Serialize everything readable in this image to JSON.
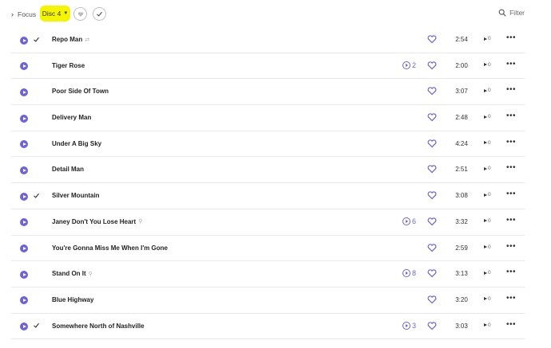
{
  "toolbar": {
    "focus_label": "Focus",
    "disc_label": "Disc 4",
    "filter_label": "Filter"
  },
  "colors": {
    "accent": "#6c63d9",
    "highlight": "#f5f500"
  },
  "tracks": [
    {
      "title": "Repo Man",
      "checked": true,
      "extra_icon": "shuffle-icon",
      "versions": "",
      "duration": "2:54",
      "plays": "0"
    },
    {
      "title": "Tiger Rose",
      "checked": false,
      "extra_icon": "",
      "versions": "2",
      "duration": "2:00",
      "plays": "0"
    },
    {
      "title": "Poor Side Of Town",
      "checked": false,
      "extra_icon": "",
      "versions": "",
      "duration": "3:07",
      "plays": "0"
    },
    {
      "title": "Delivery Man",
      "checked": false,
      "extra_icon": "",
      "versions": "",
      "duration": "2:48",
      "plays": "0"
    },
    {
      "title": "Under A Big Sky",
      "checked": false,
      "extra_icon": "",
      "versions": "",
      "duration": "4:24",
      "plays": "0"
    },
    {
      "title": "Detail Man",
      "checked": false,
      "extra_icon": "",
      "versions": "",
      "duration": "2:51",
      "plays": "0"
    },
    {
      "title": "Silver Mountain",
      "checked": true,
      "extra_icon": "",
      "versions": "",
      "duration": "3:08",
      "plays": "0"
    },
    {
      "title": "Janey Don't You Lose Heart",
      "checked": false,
      "extra_icon": "link-icon",
      "versions": "6",
      "duration": "3:32",
      "plays": "0"
    },
    {
      "title": "You're Gonna Miss Me When I'm Gone",
      "checked": false,
      "extra_icon": "",
      "versions": "",
      "duration": "2:59",
      "plays": "0"
    },
    {
      "title": "Stand On It",
      "checked": false,
      "extra_icon": "link-icon",
      "versions": "8",
      "duration": "3:13",
      "plays": "0"
    },
    {
      "title": "Blue Highway",
      "checked": false,
      "extra_icon": "",
      "versions": "",
      "duration": "3:20",
      "plays": "0"
    },
    {
      "title": "Somewhere North of Nashville",
      "checked": true,
      "extra_icon": "",
      "versions": "3",
      "duration": "3:03",
      "plays": "0"
    }
  ]
}
